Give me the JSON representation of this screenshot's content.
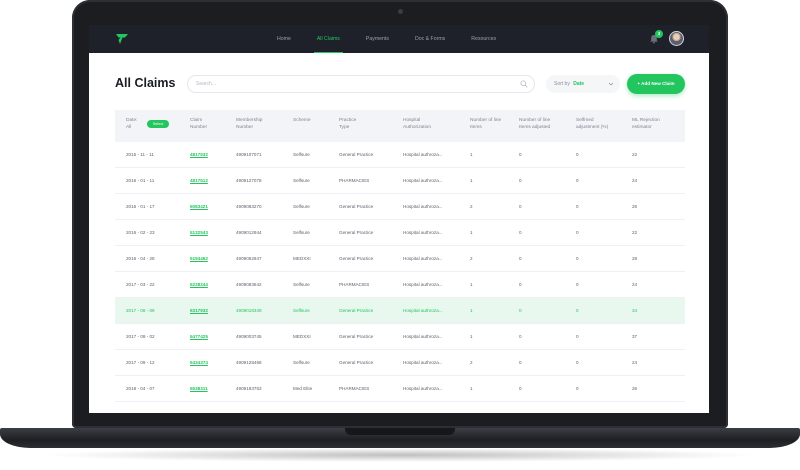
{
  "nav": {
    "items": [
      "Home",
      "All Claims",
      "Payments",
      "Doc & Forms",
      "Resources"
    ],
    "active_index": 1,
    "notification_count": "3"
  },
  "header": {
    "title": "All Claims",
    "search_placeholder": "Search...",
    "sort_label": "Sort by",
    "sort_value": "Date",
    "add_button": "+ Add New Claim"
  },
  "table": {
    "headers": {
      "date": [
        "Date:",
        "All"
      ],
      "select_chip": "Select",
      "claim_number": [
        "Claim",
        "Number"
      ],
      "membership": [
        "Membership",
        "Number"
      ],
      "scheme": [
        "Scheme"
      ],
      "practice_type": [
        "Practice",
        "Type"
      ],
      "hospital_auth": [
        "Hospital",
        "Authorization"
      ],
      "line_items": [
        "Number of line",
        "Items"
      ],
      "line_items_adjusted": [
        "Number of line",
        "Items adjusted"
      ],
      "selfmed_adjustment": [
        "Selfmed",
        "adjustment (%)"
      ],
      "ml_rejection": [
        "ML Rejection",
        "estimator"
      ]
    },
    "highlight_index": 6,
    "rows": [
      {
        "date": "2015 - 11 - 11",
        "claim": "4817532",
        "membership": "4909107071",
        "scheme": "Selfsure",
        "practice": "General Practice",
        "hospital": "Hospital authroza...",
        "items": "1",
        "adjusted": "0",
        "selfmed": "0",
        "ml": "22"
      },
      {
        "date": "2016 - 01 - 11",
        "claim": "4817512",
        "membership": "4909127078",
        "scheme": "Selfsure",
        "practice": "PHARMACIES",
        "hospital": "Hospital authroza...",
        "items": "1",
        "adjusted": "0",
        "selfmed": "0",
        "ml": "24"
      },
      {
        "date": "2016 - 01 - 17",
        "claim": "5083421",
        "membership": "4909083270",
        "scheme": "Selfsure",
        "practice": "General Practice",
        "hospital": "Hospital authroza...",
        "items": "2",
        "adjusted": "0",
        "selfmed": "0",
        "ml": "26"
      },
      {
        "date": "2016 - 02 - 23",
        "claim": "5132543",
        "membership": "4909012944",
        "scheme": "Selfsure",
        "practice": "General Practice",
        "hospital": "Hospital authroza...",
        "items": "1",
        "adjusted": "0",
        "selfmed": "0",
        "ml": "22"
      },
      {
        "date": "2016 - 04 - 28",
        "claim": "5194462",
        "membership": "4909062847",
        "scheme": "MEDXXI",
        "practice": "General Practice",
        "hospital": "Hospital authroza...",
        "items": "2",
        "adjusted": "0",
        "selfmed": "0",
        "ml": "28"
      },
      {
        "date": "2017 - 03 - 22",
        "claim": "5228244",
        "membership": "4909083642",
        "scheme": "Selfsure",
        "practice": "PHARMACIES",
        "hospital": "Hospital authroza...",
        "items": "1",
        "adjusted": "0",
        "selfmed": "0",
        "ml": "24"
      },
      {
        "date": "2017 - 08 - 09",
        "claim": "5317932",
        "membership": "4909018349",
        "scheme": "Selfsure",
        "practice": "General Practice",
        "hospital": "Hospital authroza...",
        "items": "1",
        "adjusted": "0",
        "selfmed": "0",
        "ml": "34"
      },
      {
        "date": "2017 - 08 - 02",
        "claim": "5477425",
        "membership": "4909003745",
        "scheme": "MEDXXI",
        "practice": "General Practice",
        "hospital": "Hospital authroza...",
        "items": "1",
        "adjusted": "0",
        "selfmed": "0",
        "ml": "37"
      },
      {
        "date": "2017 - 09 - 12",
        "claim": "5434374",
        "membership": "4909128468",
        "scheme": "Selfsure",
        "practice": "General Practice",
        "hospital": "Hospital authroza...",
        "items": "2",
        "adjusted": "0",
        "selfmed": "0",
        "ml": "24"
      },
      {
        "date": "2018 - 04 - 07",
        "claim": "5538311",
        "membership": "4909193763",
        "scheme": "Med Elite",
        "practice": "PHARMACIES",
        "hospital": "Hospital authroza...",
        "items": "1",
        "adjusted": "0",
        "selfmed": "0",
        "ml": "26"
      }
    ]
  },
  "colors": {
    "accent": "#22c55e",
    "nav_bg": "#1e2129",
    "highlight_row": "#e9f8ee"
  },
  "icons": [
    "logo-icon",
    "bell-icon",
    "search-icon",
    "chevron-down-icon"
  ]
}
